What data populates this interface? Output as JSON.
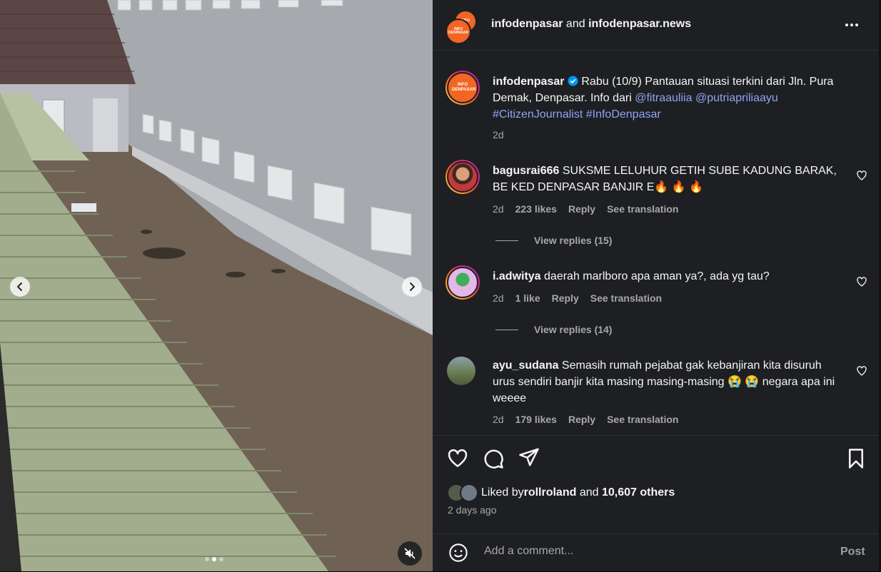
{
  "media": {
    "prev_icon": "chevron-left-icon",
    "next_icon": "chevron-right-icon",
    "mute_icon": "speaker-muted-icon",
    "carousel_dots": 3,
    "active_dot": 1
  },
  "header": {
    "account1": "infodenpasar",
    "joiner": " and ",
    "account2": "infodenpasar.news",
    "avatar_text": "INFO DENPASAR"
  },
  "caption": {
    "username": "infodenpasar",
    "text": " Rabu (10/9) Pantauan situasi terkini dari Jln. Pura Demak, Denpasar. Info dari ",
    "mention1": "@fitraauliia",
    "mention2": "@putriapriliaayu",
    "hashtag1": "#CitizenJournalist",
    "hashtag2": "#InfoDenpasar",
    "time": "2d"
  },
  "comments": [
    {
      "username": "bagusrai666",
      "text": " SUKSME LELUHUR GETIH SUBE KADUNG BARAK, BE KED DENPASAR BANJIR E🔥 🔥 🔥",
      "time": "2d",
      "likes": "223 likes",
      "reply": "Reply",
      "translate": "See translation",
      "view_replies": "View replies (15)"
    },
    {
      "username": "i.adwitya",
      "text": " daerah marlboro apa aman ya?, ada yg tau?",
      "time": "2d",
      "likes": "1 like",
      "reply": "Reply",
      "translate": "See translation",
      "view_replies": "View replies (14)"
    },
    {
      "username": "ayu_sudana",
      "text": " Semasih rumah pejabat gak kebanjiran kita disuruh urus sendiri banjir kita masing masing-masing 😭 😭 negara apa ini weeee",
      "time": "2d",
      "likes": "179 likes",
      "reply": "Reply",
      "translate": "See translation"
    }
  ],
  "likes": {
    "prefix": "Liked by ",
    "user": "rollroland",
    "joiner": " and ",
    "others": "10,607 others"
  },
  "posted_ago": "2 days ago",
  "comment_box": {
    "placeholder": "Add a comment...",
    "post_label": "Post"
  },
  "colors": {
    "panel_bg": "#1e1f22",
    "link": "#8fa3f5",
    "muted": "#a8a8a8",
    "brand_orange": "#f26522"
  }
}
